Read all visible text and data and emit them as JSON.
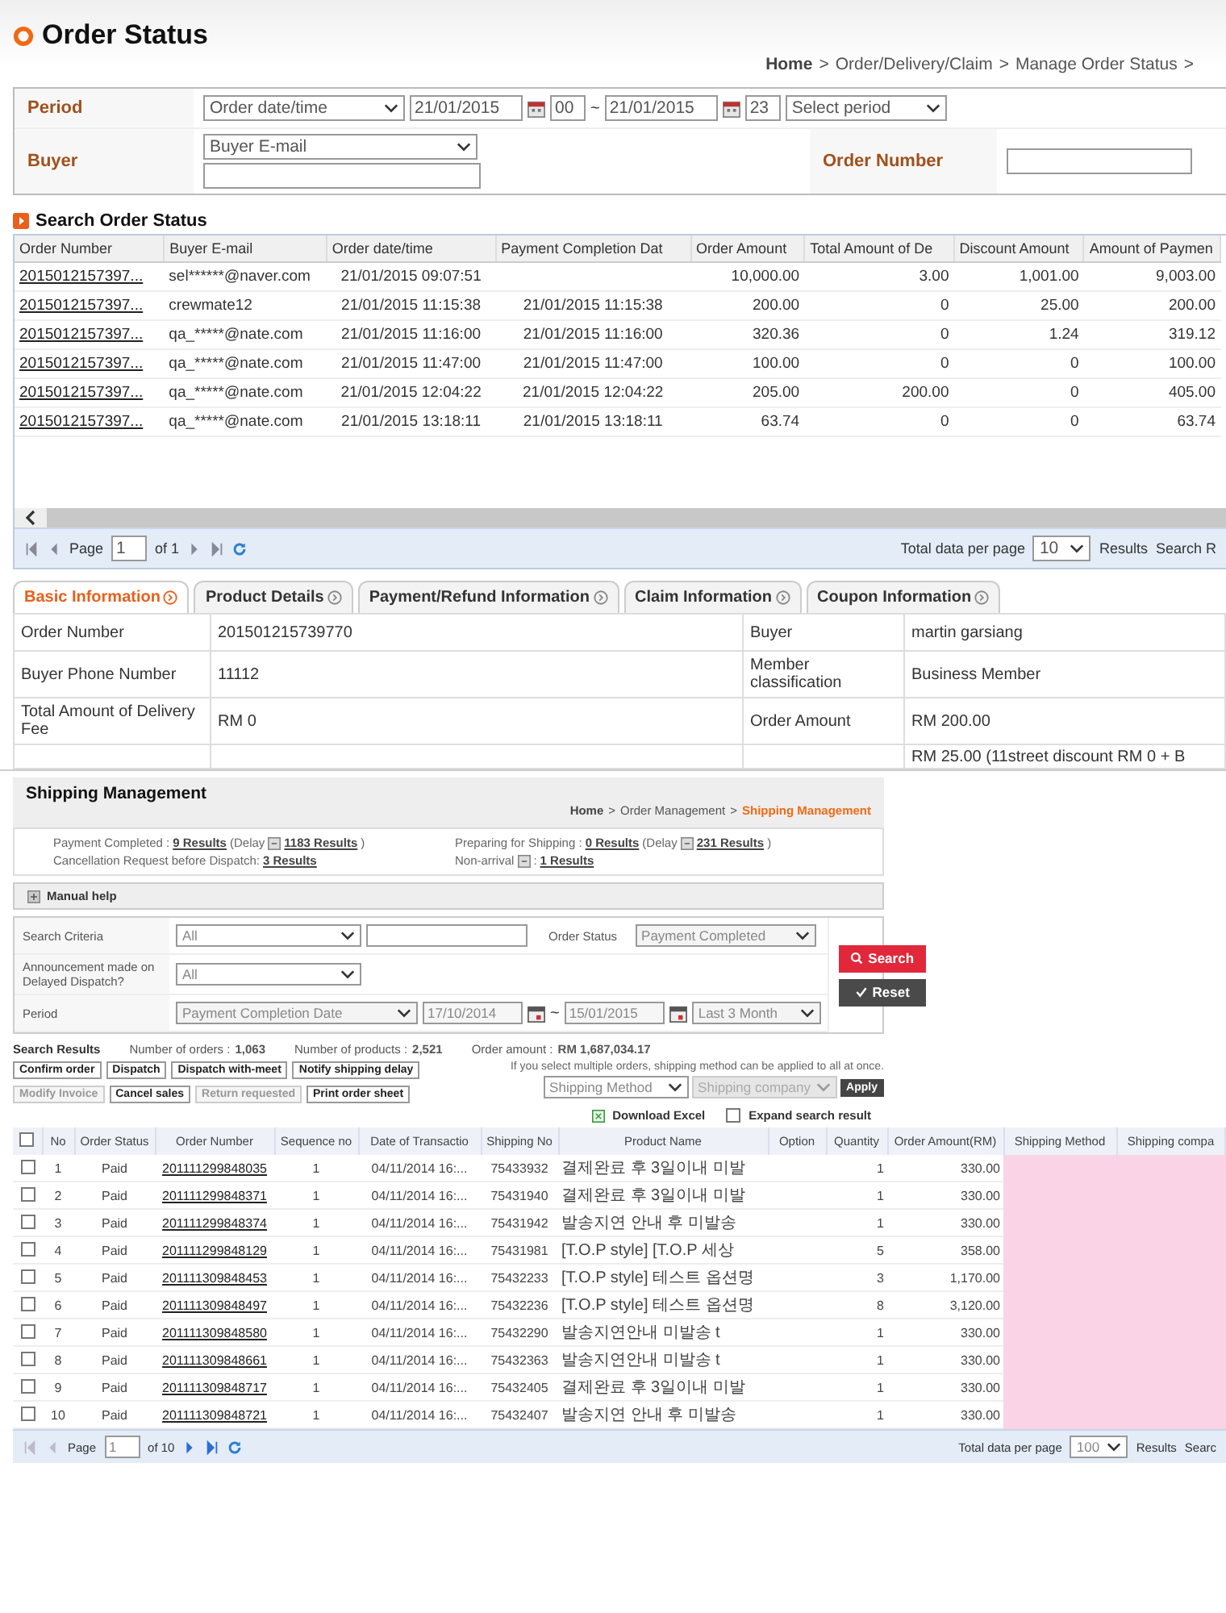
{
  "header": {
    "title": "Order Status",
    "breadcrumb": {
      "crumbs": [
        "Home",
        "Order/Delivery/Claim",
        "Manage Order Status"
      ],
      "separator": ">",
      "trailing_separator": ">"
    }
  },
  "search_form": {
    "period": {
      "label": "Period",
      "type_select": "Order date/time",
      "from_date": "21/01/2015",
      "from_hour": "00",
      "range_sep": "~",
      "to_date": "21/01/2015",
      "to_hour": "23",
      "preset_select": "Select period"
    },
    "buyer": {
      "label": "Buyer",
      "select": "Buyer E-mail"
    },
    "order_number": {
      "label": "Order Number"
    }
  },
  "orders": {
    "title": "Search Order Status",
    "columns": [
      "Order Number",
      "Buyer E-mail",
      "Order date/time",
      "Payment Completion Dat",
      "Order Amount",
      "Total Amount of De",
      "Discount Amount",
      "Amount of Paymen"
    ],
    "rows": [
      [
        "2015012157397...",
        "sel******@naver.com",
        "21/01/2015 09:07:51",
        null,
        "10,000.00",
        "3.00",
        "1,001.00",
        "9,003.00"
      ],
      [
        "2015012157397...",
        "crewmate12",
        "21/01/2015 11:15:38",
        "21/01/2015 11:15:38",
        "200.00",
        "0",
        "25.00",
        "200.00"
      ],
      [
        "2015012157397...",
        "qa_*****@nate.com",
        "21/01/2015 11:16:00",
        "21/01/2015 11:16:00",
        "320.36",
        "0",
        "1.24",
        "319.12"
      ],
      [
        "2015012157397...",
        "qa_*****@nate.com",
        "21/01/2015 11:47:00",
        "21/01/2015 11:47:00",
        "100.00",
        "0",
        "0",
        "100.00"
      ],
      [
        "2015012157397...",
        "qa_*****@nate.com",
        "21/01/2015 12:04:22",
        "21/01/2015 12:04:22",
        "205.00",
        "200.00",
        "0",
        "405.00"
      ],
      [
        "2015012157397...",
        "qa_*****@nate.com",
        "21/01/2015 13:18:11",
        "21/01/2015 13:18:11",
        "63.74",
        "0",
        "0",
        "63.74"
      ]
    ],
    "pager": {
      "page_label": "Page",
      "page": "1",
      "of": "of 1",
      "per_page_label": "Total data per page",
      "per_page": "10",
      "results_label": "Results",
      "search_cut": "Search R"
    }
  },
  "tabs": [
    {
      "label": "Basic Information",
      "selected": true
    },
    {
      "label": "Product Details",
      "selected": false
    },
    {
      "label": "Payment/Refund Information",
      "selected": false
    },
    {
      "label": "Claim Information",
      "selected": false
    },
    {
      "label": "Coupon Information",
      "selected": false
    }
  ],
  "info_rows": [
    {
      "label": "Order Number",
      "value": "201501215739770",
      "label2": "Buyer",
      "value2": "martin garsiang"
    },
    {
      "label": "Buyer Phone Number",
      "value": "11112",
      "label2": "Member classification",
      "value2": "Business Member"
    },
    {
      "label": "Total Amount of Delivery Fee",
      "value": "RM 0",
      "label2": "Order Amount",
      "value2": "RM 200.00"
    },
    {
      "value2": "RM 25.00 (11street discount RM 0 + B"
    }
  ],
  "shipping": {
    "title": "Shipping Management",
    "breadcrumb": {
      "crumbs": [
        "Home",
        "Order Management",
        "Shipping Management"
      ],
      "separator": ">"
    },
    "stats": [
      {
        "kind": "delay",
        "label": "Payment Completed :",
        "link": "9 Results",
        "delay_label": "(Delay",
        "delay_link": "1183 Results",
        "delay_end": ")"
      },
      {
        "kind": "delay",
        "label": "Preparing for Shipping :",
        "link": "0 Results",
        "delay_label": "(Delay",
        "delay_link": "231 Results",
        "delay_end": ")"
      },
      {
        "kind": "plain",
        "label": "Cancellation Request before Dispatch:",
        "link": "3 Results"
      },
      {
        "kind": "icon",
        "label": "Non-arrival",
        "after_icon": ":",
        "link": "1 Results"
      }
    ],
    "help": "Manual help",
    "form": {
      "criteria": {
        "label": "Search Criteria",
        "select": "All"
      },
      "status": {
        "label": "Order Status",
        "select": "Payment Completed"
      },
      "delayed": {
        "label": "Announcement made on Delayed Dispatch?",
        "select": "All"
      },
      "period": {
        "label": "Period",
        "select": "Payment Completion Date",
        "from": "17/10/2014",
        "sep": "~",
        "to": "15/01/2015",
        "preset": "Last 3 Month"
      },
      "search_button": "Search",
      "reset_button": "Reset"
    },
    "results": {
      "label": "Search Results",
      "stats": [
        {
          "label": "Number of orders :",
          "value": "1,063"
        },
        {
          "label": "Number of products :",
          "value": "2,521"
        },
        {
          "label": "Order amount :",
          "value": "RM 1,687,034.17"
        }
      ]
    },
    "actions": [
      [
        {
          "label": "Confirm order",
          "disabled": false
        },
        {
          "label": "Dispatch",
          "disabled": false
        },
        {
          "label": "Dispatch with-meet",
          "disabled": false
        },
        {
          "label": "Notify shipping delay",
          "disabled": false
        }
      ],
      [
        {
          "label": "Modify Invoice",
          "disabled": true
        },
        {
          "label": "Cancel sales",
          "disabled": false
        },
        {
          "label": "Return requested",
          "disabled": true
        },
        {
          "label": "Print order sheet",
          "disabled": false
        }
      ]
    ],
    "bulk": {
      "note": "If you select multiple orders, shipping method can be applied to all at once.",
      "method_select": "Shipping Method",
      "company_select": "Shipping company",
      "apply": "Apply"
    },
    "download": "Download Excel",
    "expand": {
      "label": "Expand search result",
      "checked": false
    },
    "table": {
      "select_all_checked": false,
      "columns": [
        "No",
        "Order Status",
        "Order Number",
        "Sequence no",
        "Date of Transactio",
        "Shipping No",
        "Product Name",
        "Option",
        "Quantity",
        "Order Amount(RM)",
        "Shipping Method",
        "Shipping compa"
      ],
      "rows": [
        {
          "checked": false,
          "cells": [
            "1",
            "Paid",
            "201111299848035",
            "1",
            "04/11/2014 16:...",
            "75433932",
            "결제완료 후 3일이내 미발",
            "",
            "1",
            "330.00"
          ]
        },
        {
          "checked": false,
          "cells": [
            "2",
            "Paid",
            "201111299848371",
            "1",
            "04/11/2014 16:...",
            "75431940",
            "결제완료 후 3일이내 미발",
            "",
            "1",
            "330.00"
          ]
        },
        {
          "checked": false,
          "cells": [
            "3",
            "Paid",
            "201111299848374",
            "1",
            "04/11/2014 16:...",
            "75431942",
            "발송지연 안내 후 미발송",
            "",
            "1",
            "330.00"
          ]
        },
        {
          "checked": false,
          "cells": [
            "4",
            "Paid",
            "201111299848129",
            "1",
            "04/11/2014 16:...",
            "75431981",
            "[T.O.P style] [T.O.P 세상",
            "",
            "5",
            "358.00"
          ]
        },
        {
          "checked": false,
          "cells": [
            "5",
            "Paid",
            "201111309848453",
            "1",
            "04/11/2014 16:...",
            "75432233",
            "[T.O.P style] 테스트 옵션명",
            "",
            "3",
            "1,170.00"
          ]
        },
        {
          "checked": false,
          "cells": [
            "6",
            "Paid",
            "201111309848497",
            "1",
            "04/11/2014 16:...",
            "75432236",
            "[T.O.P style] 테스트 옵션명",
            "",
            "8",
            "3,120.00"
          ]
        },
        {
          "checked": false,
          "cells": [
            "7",
            "Paid",
            "201111309848580",
            "1",
            "04/11/2014 16:...",
            "75432290",
            "발송지연안내 미발송 t",
            "",
            "1",
            "330.00"
          ]
        },
        {
          "checked": false,
          "cells": [
            "8",
            "Paid",
            "201111309848661",
            "1",
            "04/11/2014 16:...",
            "75432363",
            "발송지연안내 미발송 t",
            "",
            "1",
            "330.00"
          ]
        },
        {
          "checked": false,
          "cells": [
            "9",
            "Paid",
            "201111309848717",
            "1",
            "04/11/2014 16:...",
            "75432405",
            "결제완료 후 3일이내 미발",
            "",
            "1",
            "330.00"
          ]
        },
        {
          "checked": false,
          "cells": [
            "10",
            "Paid",
            "201111309848721",
            "1",
            "04/11/2014 16:...",
            "75432407",
            "발송지연 안내 후 미발송",
            "",
            "1",
            "330.00"
          ]
        }
      ]
    },
    "pager": {
      "page_label": "Page",
      "page": "1",
      "of": "of 10",
      "per_page_label": "Total data per page",
      "per_page": "100",
      "results_label": "Results",
      "search_cut": "Searc"
    }
  }
}
